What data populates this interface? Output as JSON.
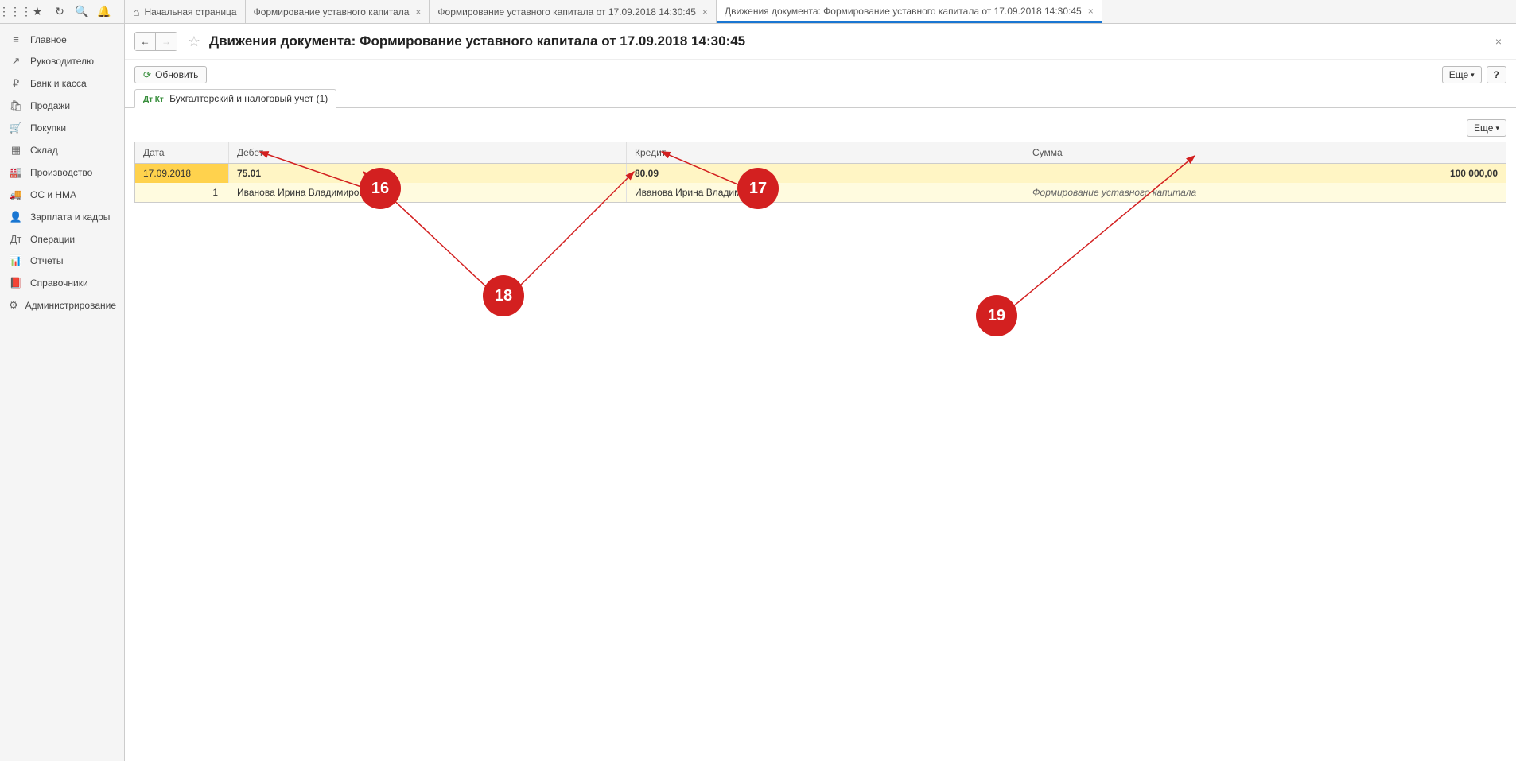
{
  "toolbar": {
    "apps_icon": "apps",
    "star_icon": "star",
    "history_icon": "history",
    "search_icon": "search",
    "bell_icon": "bell"
  },
  "tabs": {
    "home": "Начальная страница",
    "t1": "Формирование уставного капитала",
    "t2": "Формирование уставного капитала от 17.09.2018 14:30:45",
    "t3": "Движения документа: Формирование уставного капитала от 17.09.2018 14:30:45"
  },
  "sidebar": {
    "items": [
      {
        "icon": "≡",
        "label": "Главное"
      },
      {
        "icon": "↗",
        "label": "Руководителю"
      },
      {
        "icon": "₽",
        "label": "Банк и касса"
      },
      {
        "icon": "🛍",
        "label": "Продажи"
      },
      {
        "icon": "🛒",
        "label": "Покупки"
      },
      {
        "icon": "▦",
        "label": "Склад"
      },
      {
        "icon": "🏭",
        "label": "Производство"
      },
      {
        "icon": "🚚",
        "label": "ОС и НМА"
      },
      {
        "icon": "👤",
        "label": "Зарплата и кадры"
      },
      {
        "icon": "Дт",
        "label": "Операции"
      },
      {
        "icon": "📊",
        "label": "Отчеты"
      },
      {
        "icon": "📕",
        "label": "Справочники"
      },
      {
        "icon": "⚙",
        "label": "Администрирование"
      }
    ]
  },
  "header": {
    "title": "Движения документа: Формирование уставного капитала от 17.09.2018 14:30:45"
  },
  "actions": {
    "refresh": "Обновить",
    "more": "Еще",
    "help": "?"
  },
  "section_tab": "Бухгалтерский и налоговый учет (1)",
  "table": {
    "headers": {
      "date": "Дата",
      "debit": "Дебет",
      "credit": "Кредит",
      "sum": "Сумма"
    },
    "row1": {
      "date": "17.09.2018",
      "debit": "75.01",
      "credit": "80.09",
      "sum": "100 000,00"
    },
    "row2": {
      "num": "1",
      "debit": "Иванова Ирина Владимировна",
      "credit": "Иванова Ирина Владимировна",
      "note": "Формирование уставного капитала"
    }
  },
  "annotations": {
    "a16": "16",
    "a17": "17",
    "a18": "18",
    "a19": "19"
  }
}
